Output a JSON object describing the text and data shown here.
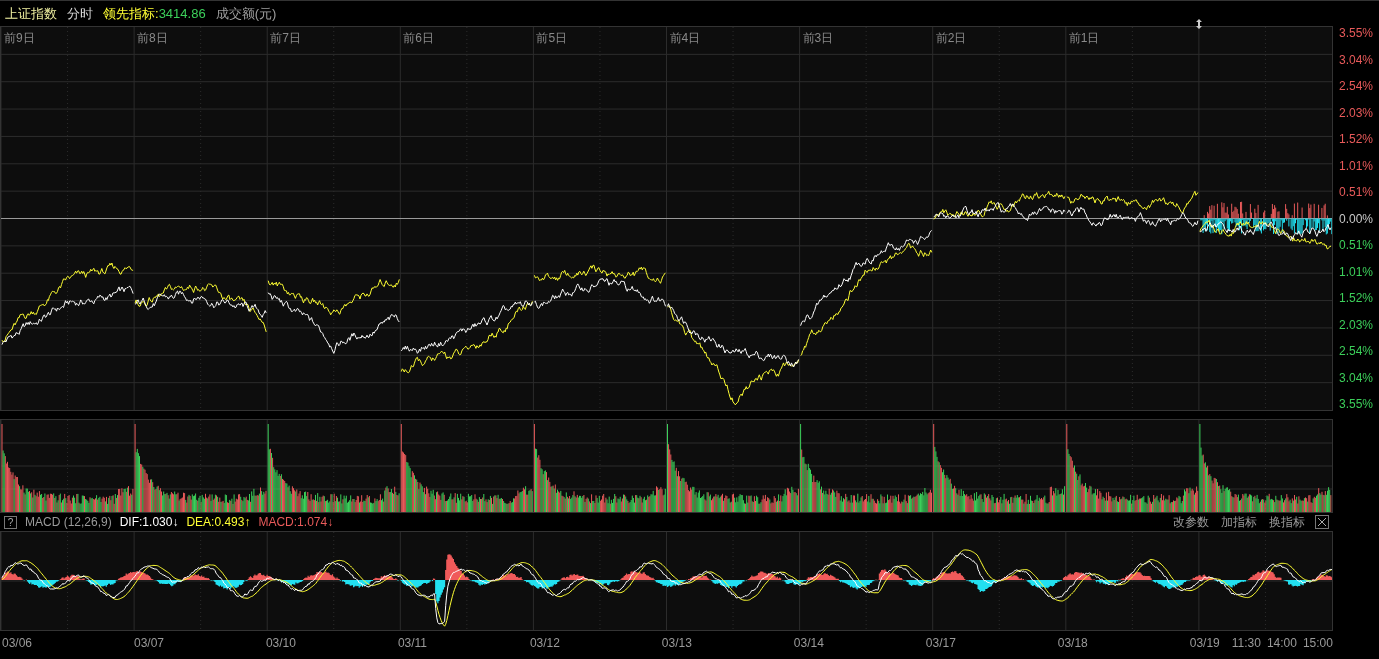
{
  "header": {
    "title": "上证指数",
    "mode": "分时",
    "indicator_label": "领先指标:",
    "indicator_value": "3414.86",
    "volume_label": "成交额(元)"
  },
  "day_labels": [
    "前9日",
    "前8日",
    "前7日",
    "前6日",
    "前5日",
    "前4日",
    "前3日",
    "前2日",
    "前1日"
  ],
  "y_axis": [
    {
      "label": "3.55%",
      "kind": "up"
    },
    {
      "label": "3.04%",
      "kind": "up"
    },
    {
      "label": "2.54%",
      "kind": "up"
    },
    {
      "label": "2.03%",
      "kind": "up"
    },
    {
      "label": "1.52%",
      "kind": "up"
    },
    {
      "label": "1.01%",
      "kind": "up"
    },
    {
      "label": "0.51%",
      "kind": "up"
    },
    {
      "label": "0.00%",
      "kind": "flat"
    },
    {
      "label": "0.51%",
      "kind": "down"
    },
    {
      "label": "1.01%",
      "kind": "down"
    },
    {
      "label": "1.52%",
      "kind": "down"
    },
    {
      "label": "2.03%",
      "kind": "down"
    },
    {
      "label": "2.54%",
      "kind": "down"
    },
    {
      "label": "3.04%",
      "kind": "down"
    },
    {
      "label": "3.55%",
      "kind": "down"
    }
  ],
  "macd": {
    "help": "?",
    "title": "MACD (12,26,9)",
    "values": [
      {
        "kind": "dif",
        "label": "DIF:1.030↓"
      },
      {
        "kind": "dea",
        "label": "DEA:0.493↑"
      },
      {
        "kind": "macd",
        "label": "MACD:1.074↓"
      }
    ],
    "buttons": [
      "改参数",
      "加指标",
      "换指标"
    ]
  },
  "dates": [
    "03/06",
    "03/07",
    "03/10",
    "03/11",
    "03/12",
    "03/13",
    "03/14",
    "03/17",
    "03/18",
    "03/19"
  ],
  "times": [
    "11:30",
    "14:00",
    "15:00"
  ]
}
